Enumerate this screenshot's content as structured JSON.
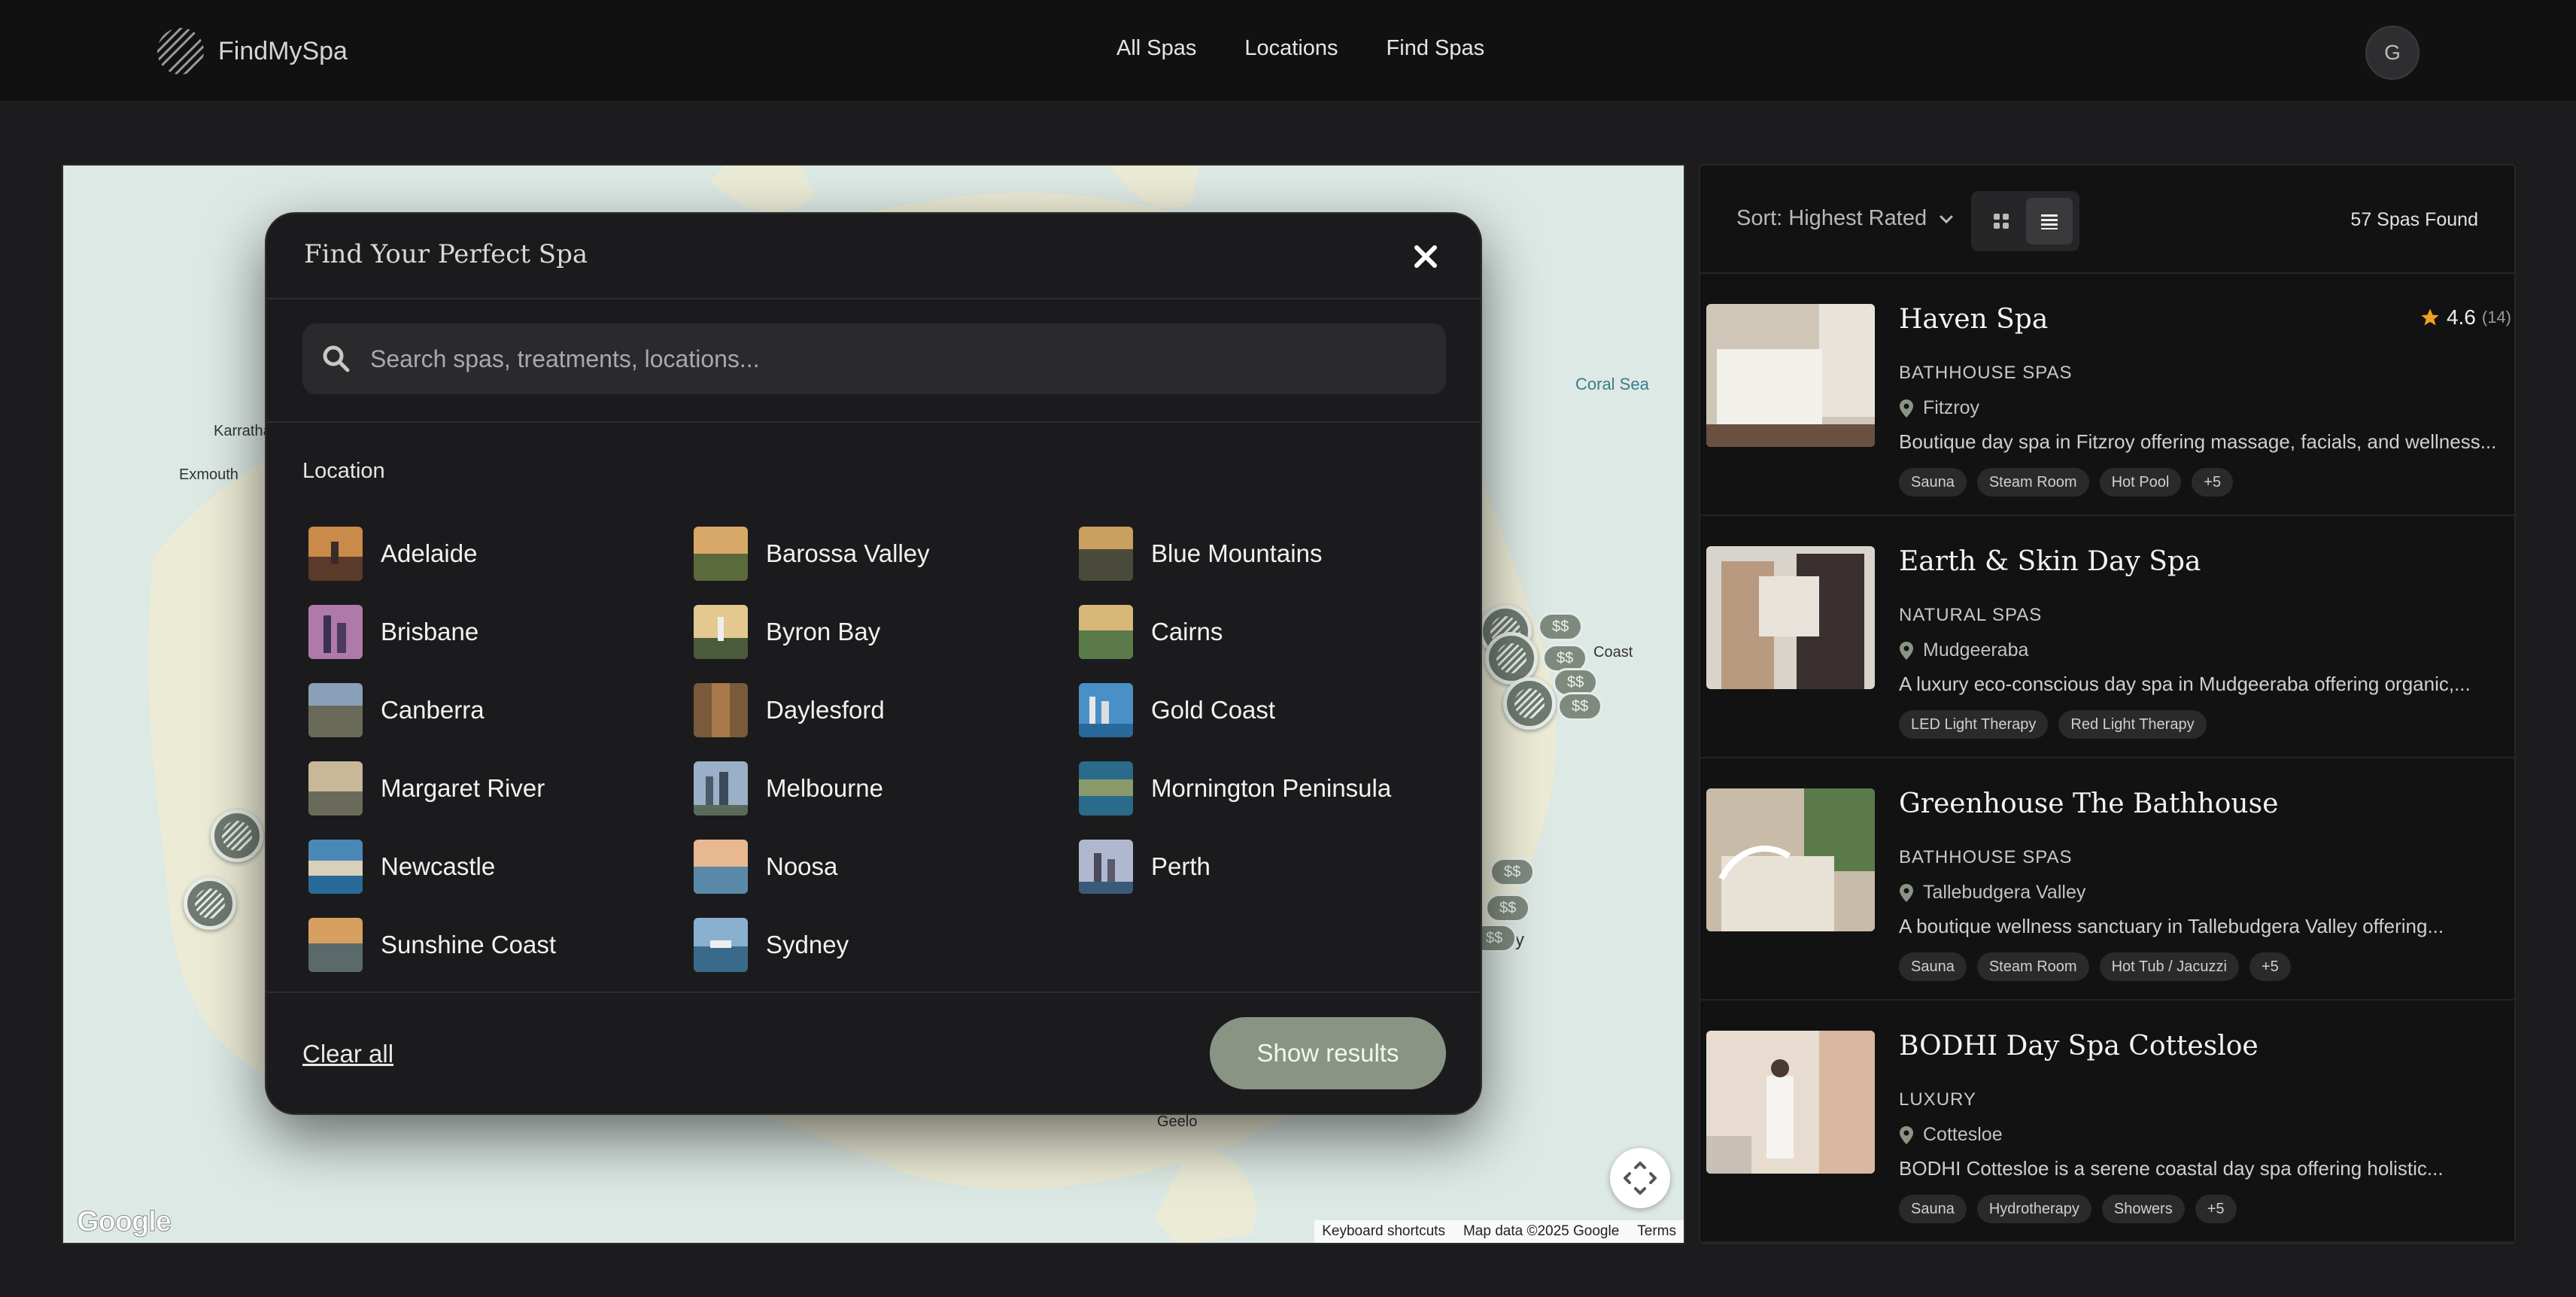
{
  "header": {
    "logo_text": "FindMySpa",
    "nav": [
      "All Spas",
      "Locations",
      "Find Spas"
    ],
    "avatar_initial": "G"
  },
  "map": {
    "labels": {
      "karratha": "Karratha",
      "exmouth": "Exmouth",
      "coral_sea": "Coral Sea",
      "coast": "Coast",
      "geelong": "Geelo",
      "y_partial": "y"
    },
    "price_label": "$$",
    "footer": {
      "shortcuts": "Keyboard shortcuts",
      "map_data": "Map data ©2025 Google",
      "terms": "Terms"
    },
    "google": "Google"
  },
  "modal": {
    "title": "Find Your Perfect Spa",
    "search_placeholder": "Search spas, treatments, locations...",
    "section_label": "Location",
    "locations": [
      "Adelaide",
      "Barossa Valley",
      "Blue Mountains",
      "Brisbane",
      "Byron Bay",
      "Cairns",
      "Canberra",
      "Daylesford",
      "Gold Coast",
      "Margaret River",
      "Melbourne",
      "Mornington Peninsula",
      "Newcastle",
      "Noosa",
      "Perth",
      "Sunshine Coast",
      "Sydney"
    ],
    "clear_label": "Clear all",
    "show_results_label": "Show results"
  },
  "panel": {
    "sort_label": "Sort: Highest Rated",
    "count": "57 Spas Found",
    "spas": [
      {
        "name": "Haven Spa",
        "rating": "4.6",
        "reviews": "(14)",
        "category": "BATHHOUSE SPAS",
        "location": "Fitzroy",
        "description": "Boutique day spa in Fitzroy offering massage, facials, and wellness...",
        "tags": [
          "Sauna",
          "Steam Room",
          "Hot Pool",
          "+5"
        ]
      },
      {
        "name": "Earth & Skin Day Spa",
        "category": "NATURAL SPAS",
        "location": "Mudgeeraba",
        "description": "A luxury eco-conscious day spa in Mudgeeraba offering organic,...",
        "tags": [
          "LED Light Therapy",
          "Red Light Therapy"
        ]
      },
      {
        "name": "Greenhouse The Bathhouse",
        "category": "BATHHOUSE SPAS",
        "location": "Tallebudgera Valley",
        "description": "A boutique wellness sanctuary in Tallebudgera Valley offering...",
        "tags": [
          "Sauna",
          "Steam Room",
          "Hot Tub / Jacuzzi",
          "+5"
        ]
      },
      {
        "name": "BODHI Day Spa Cottesloe",
        "category": "LUXURY",
        "location": "Cottesloe",
        "description": "BODHI Cottesloe is a serene coastal day spa offering holistic...",
        "tags": [
          "Sauna",
          "Hydrotherapy",
          "Showers",
          "+5"
        ]
      }
    ]
  },
  "colors": {
    "accent": "#8a9484",
    "star": "#f0a020",
    "background": "#1c1c1e"
  }
}
